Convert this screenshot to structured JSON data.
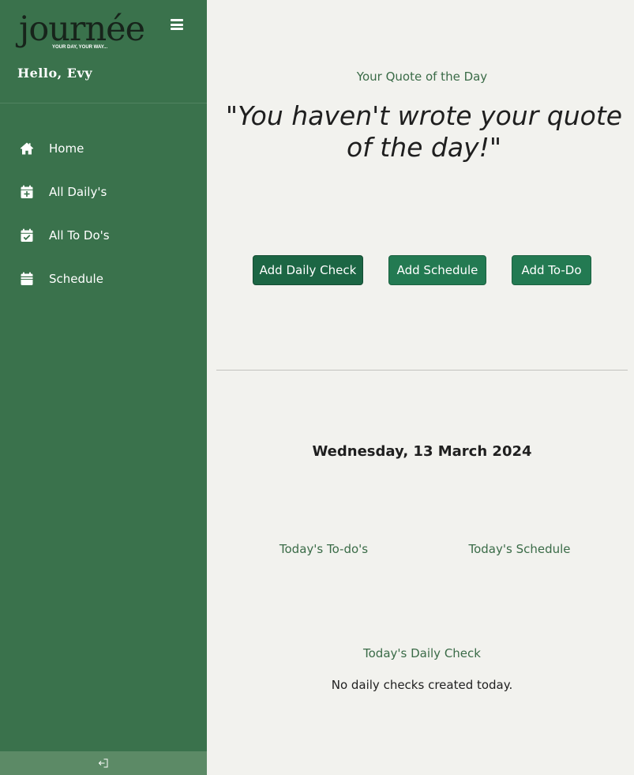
{
  "sidebar": {
    "logo": "journée",
    "tagline": "YOUR DAY, YOUR WAY...",
    "greeting": "Hello, Evy",
    "items": [
      {
        "label": "Home",
        "icon": "home-icon"
      },
      {
        "label": "All Daily's",
        "icon": "calendar-plus-icon"
      },
      {
        "label": "All To Do's",
        "icon": "calendar-check-icon"
      },
      {
        "label": "Schedule",
        "icon": "calendar-icon"
      }
    ],
    "logout_icon": "logout-icon"
  },
  "main": {
    "quote_heading": "Your Quote of the Day",
    "quote_text": "\"You haven't wrote your quote of the day!\"",
    "buttons": {
      "daily_check": "Add Daily Check",
      "schedule": "Add Schedule",
      "todo": "Add To-Do"
    },
    "date": "Wednesday, 13 March 2024",
    "todays_todos": "Today's To-do's",
    "todays_schedule": "Today's Schedule",
    "todays_daily_check": "Today's Daily Check",
    "no_daily_checks": "No daily checks created today."
  },
  "colors": {
    "sidebar_bg": "#3a724c",
    "accent_green": "#237a52",
    "label_green": "#3a6b47",
    "page_bg": "#f2f2ee"
  }
}
